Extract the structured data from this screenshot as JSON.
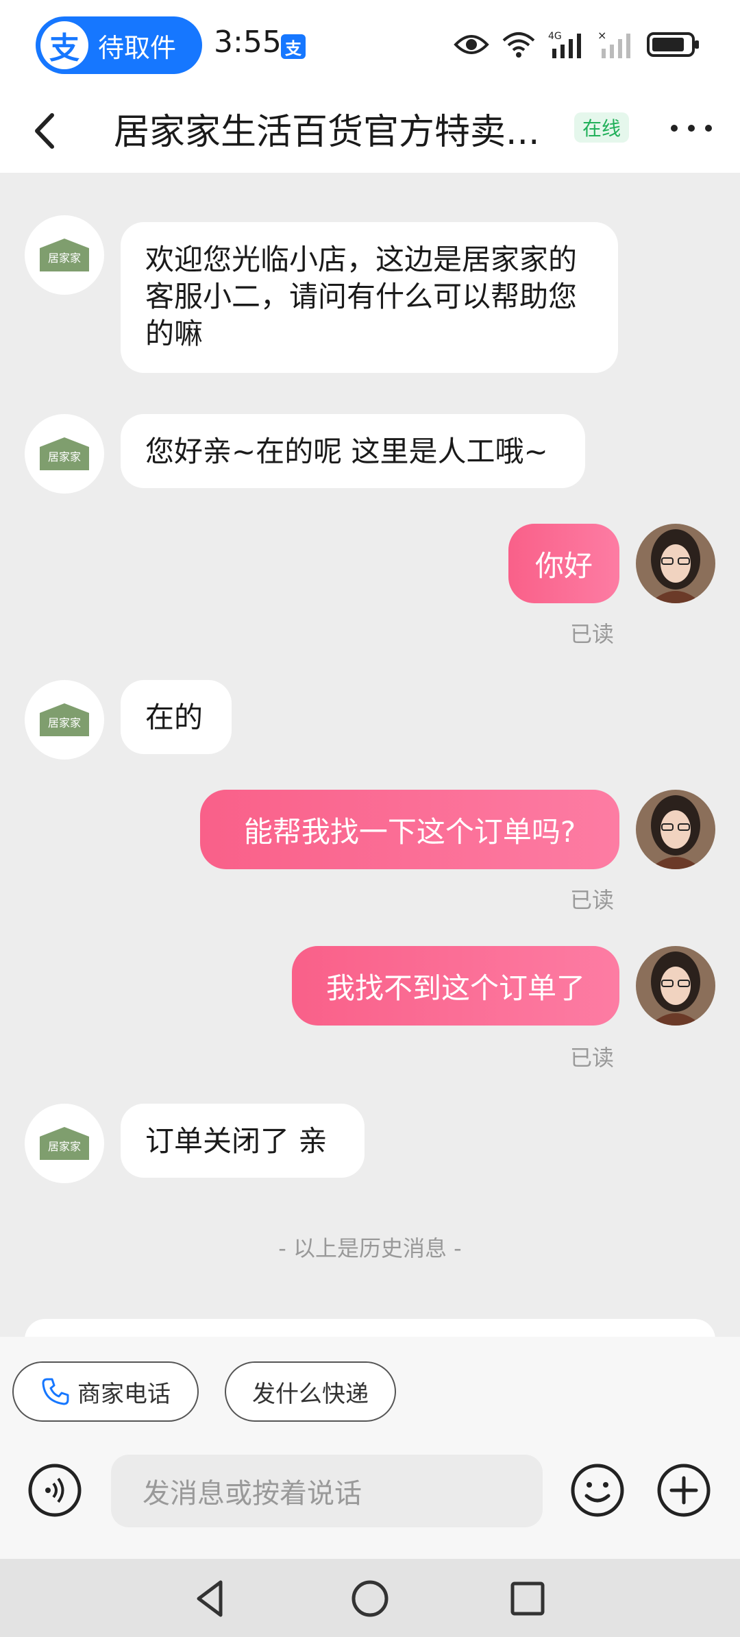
{
  "status_bar": {
    "app_pill_label": "待取件",
    "app_logo_char": "支",
    "time": "3:55",
    "mini_logo_char": "支",
    "icons": [
      "eye-icon",
      "wifi-icon",
      "4g-signal-icon",
      "no-sim-signal-icon",
      "battery-icon"
    ]
  },
  "header": {
    "title": "居家家生活百货官方特卖...",
    "status_badge": "在线",
    "back_icon": "chevron-left-icon",
    "more_icon": "more-dots-icon"
  },
  "shop": {
    "avatar_text": "居家家",
    "brand_color": "#7f9e6e"
  },
  "messages": [
    {
      "side": "left",
      "text": "欢迎您光临小店，这边是居家家的客服小二，请问有什么可以帮助您的嘛"
    },
    {
      "side": "left",
      "text": "您好亲~在的呢 这里是人工哦~"
    },
    {
      "side": "right",
      "text": "你好",
      "status": "已读"
    },
    {
      "side": "left",
      "text": "在的"
    },
    {
      "side": "right",
      "text": "能帮我找一下这个订单吗?",
      "status": "已读"
    },
    {
      "side": "right",
      "text": "我找不到这个订单了",
      "status": "已读"
    },
    {
      "side": "left",
      "text": "订单关闭了 亲"
    }
  ],
  "history_divider": "- 以上是历史消息 -",
  "quick_replies": [
    {
      "label": "商家电话",
      "icon": "phone-icon"
    },
    {
      "label": "发什么快递"
    }
  ],
  "input": {
    "placeholder": "发消息或按着说话",
    "voice_icon": "voice-icon",
    "emoji_icon": "emoji-icon",
    "plus_icon": "plus-icon"
  },
  "colors": {
    "accent_blue": "#1677ff",
    "bubble_pink": "#f96089",
    "online_green": "#22b05a"
  },
  "nav": [
    "back-triangle-icon",
    "home-circle-icon",
    "recents-square-icon"
  ]
}
